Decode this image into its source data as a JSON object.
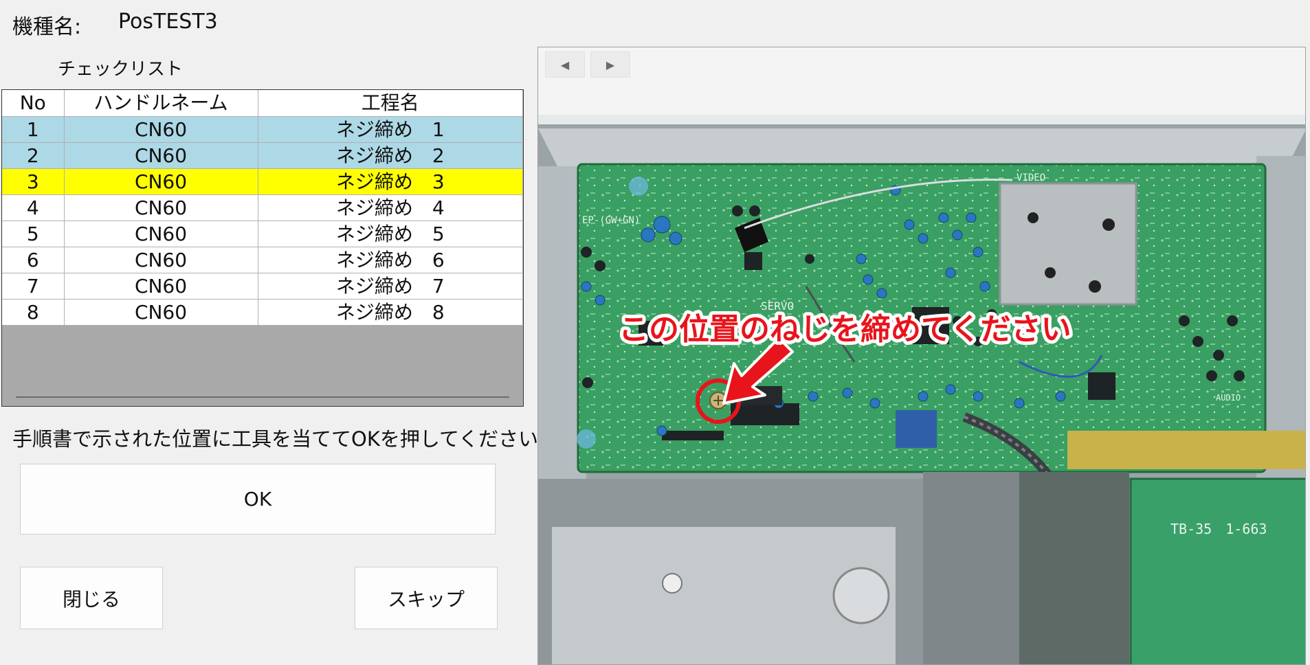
{
  "header": {
    "model_label": "機種名:",
    "model_value": "PosTEST3"
  },
  "checklist": {
    "label": "チェックリスト",
    "columns": [
      "No",
      "ハンドルネーム",
      "工程名"
    ],
    "rows": [
      {
        "no": "1",
        "handle": "CN60",
        "process": "ネジ締め　1",
        "state": "done"
      },
      {
        "no": "2",
        "handle": "CN60",
        "process": "ネジ締め　2",
        "state": "done"
      },
      {
        "no": "3",
        "handle": "CN60",
        "process": "ネジ締め　3",
        "state": "current"
      },
      {
        "no": "4",
        "handle": "CN60",
        "process": "ネジ締め　4",
        "state": "pending"
      },
      {
        "no": "5",
        "handle": "CN60",
        "process": "ネジ締め　5",
        "state": "pending"
      },
      {
        "no": "6",
        "handle": "CN60",
        "process": "ネジ締め　6",
        "state": "pending"
      },
      {
        "no": "7",
        "handle": "CN60",
        "process": "ネジ締め　7",
        "state": "pending"
      },
      {
        "no": "8",
        "handle": "CN60",
        "process": "ネジ締め　8",
        "state": "pending"
      }
    ]
  },
  "instruction": "手順書で示された位置に工具を当ててOKを押してください。",
  "buttons": {
    "ok": "OK",
    "close": "閉じる",
    "skip": "スキップ"
  },
  "viewer": {
    "prev_icon": "triangle-left-icon",
    "next_icon": "triangle-right-icon",
    "callout": "この位置のねじを締めてください",
    "board_labels": {
      "servo": "SERVO",
      "video": "VIDEO",
      "audio": "AUDIO",
      "part": "TB-35　1-663",
      "silk": "EP-(GW+GN)"
    }
  },
  "colors": {
    "row_done": "#add8e6",
    "row_current": "#ffff00",
    "callout_red": "#e8141c",
    "pcb_green": "#2f9a5a"
  }
}
